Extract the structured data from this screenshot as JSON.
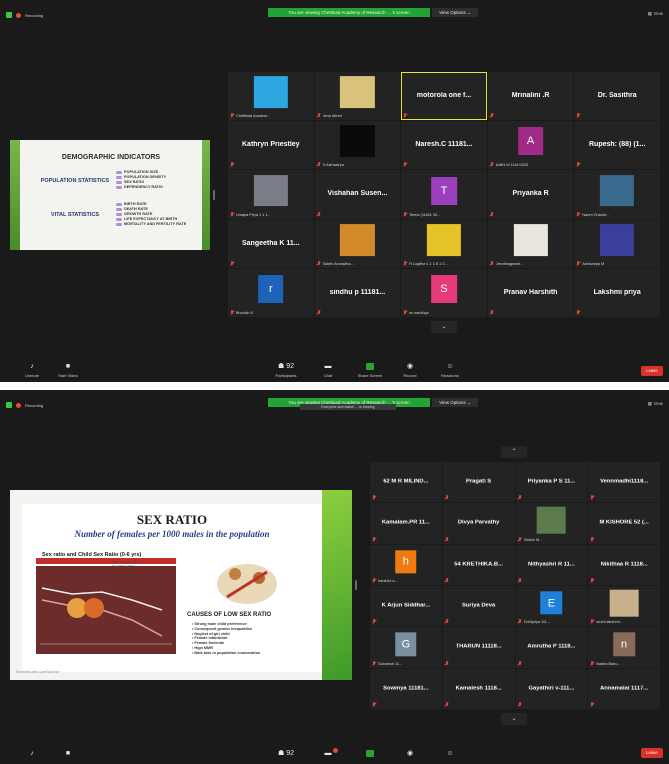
{
  "shots": [
    {
      "recording": "Recording",
      "banner": "You are viewing Chettinad Academy of Research ... 's screen",
      "view_options": "View Options ⌄",
      "view": "View",
      "slide": {
        "title": "DEMOGRAPHIC INDICATORS",
        "population_heading": "POPULATION STATISTICS",
        "population_items": [
          "POPULATION SIZE",
          "POPULATION DENSITY",
          "SEX RATIO",
          "DEPENDENCY RATIO"
        ],
        "vital_heading": "VITAL STATISTICS",
        "vital_items": [
          "BIRTH RATE",
          "DEATH RATE",
          "GROWTH RATE",
          "LIFE EXPECTANCY AT BIRTH",
          "MORTALITY AND FERTILITY RATE"
        ]
      },
      "tiles": [
        {
          "type": "image",
          "color": "#2ea6e0",
          "label": "Chettinad Academ..."
        },
        {
          "type": "image",
          "color": "#d9c27a",
          "label": "Jerry Alfred"
        },
        {
          "type": "name",
          "name": "motorola one f...",
          "active": true
        },
        {
          "type": "name",
          "name": "Mrinalini .R"
        },
        {
          "type": "name",
          "name": "Dr. Sasithra"
        },
        {
          "type": "name",
          "name": "Kathryn Priestley"
        },
        {
          "type": "image",
          "color": "#0a0a0a",
          "label": "D Aishwarya"
        },
        {
          "type": "name",
          "name": "Naresh.C 11181..."
        },
        {
          "type": "letter",
          "letter": "A",
          "color": "#a02a86",
          "label": "Adithi M 1118 0003"
        },
        {
          "type": "name",
          "name": "Rupesh: (88) (1..."
        },
        {
          "type": "image",
          "color": "#7a7d88",
          "label": "Umapa Priya 1 1 1..."
        },
        {
          "type": "name",
          "name": "Vishahan Susen..."
        },
        {
          "type": "letter",
          "letter": "T",
          "color": "#9b3fbf",
          "label": "Teena (11811 00..."
        },
        {
          "type": "name",
          "name": "Priyanka R"
        },
        {
          "type": "image",
          "color": "#3a6b8f",
          "label": "Naren Chandr..."
        },
        {
          "type": "name",
          "name": "Sangeetha K 11..."
        },
        {
          "type": "image",
          "color": "#d38a2b",
          "label": "Sakthi Anuradha..."
        },
        {
          "type": "image",
          "color": "#e7c32a",
          "label": "R Logitha 1 1 1 8 1 0..."
        },
        {
          "type": "image",
          "color": "#e9e6df",
          "label": "Jeevithagnesh..."
        },
        {
          "type": "image",
          "color": "#3b3f9b",
          "label": "Aishwarya M"
        },
        {
          "type": "letter",
          "letter": "r",
          "color": "#1e63b8",
          "label": "Bhuvish.K"
        },
        {
          "type": "name",
          "name": "sindhu p 11181..."
        },
        {
          "type": "letter",
          "letter": "S",
          "color": "#e53b7a",
          "label": "sri sandhya"
        },
        {
          "type": "name",
          "name": "Pranav Harshith"
        },
        {
          "type": "name",
          "name": "Lakshmi priya"
        }
      ],
      "toolbar": [
        {
          "icon": "microphone-icon",
          "label": "Unmute",
          "glyph": "♪"
        },
        {
          "icon": "video-icon",
          "label": "Start Video",
          "glyph": "■"
        },
        {
          "icon": "participants-icon",
          "label": "Participants",
          "glyph": "☗ 92"
        },
        {
          "icon": "chat-icon",
          "label": "Chat",
          "glyph": "▬"
        },
        {
          "icon": "share-screen-icon",
          "label": "Share Screen",
          "glyph": ""
        },
        {
          "icon": "record-icon",
          "label": "Record",
          "glyph": "◉"
        },
        {
          "icon": "reactions-icon",
          "label": "Reactions",
          "glyph": "☺"
        }
      ],
      "leave": "Leave"
    },
    {
      "recording": "Recording",
      "banner": "You are viewing Chettinad Academy of Research ... 's screen",
      "banner_sub": "Everyone and Isabel ... is viewing",
      "view_options": "View Options ⌄",
      "view": "View",
      "slide": {
        "title": "SEX RATIO",
        "subtitle": "Number of females per 1000 males in the population",
        "chart_title": "Sex ratio and Child Sex Ratio (0-6 yrs)",
        "legend": [
          "Child Sex Ratio (0-6)",
          "Overall Sex Ratio"
        ],
        "causes_title": "CAUSES OF LOW SEX RATIO",
        "causes": [
          "Strong male child preference",
          "Consequent gender inequalities",
          "Neglect of girl child",
          "Female infanticide",
          "Female foeticide",
          "High MMR",
          "Male bias in population enumeration"
        ],
        "footer": "Scanned with CamScanner"
      },
      "tiles": [
        {
          "type": "name",
          "name": "62 M R MILIND..."
        },
        {
          "type": "name",
          "name": "Pragati S"
        },
        {
          "type": "name",
          "name": "Priyanka P S 11..."
        },
        {
          "type": "name",
          "name": "Vennmadhi1118..."
        },
        {
          "type": "name",
          "name": "Kamalam.PR 11..."
        },
        {
          "type": "name",
          "name": "Divya Parvathy"
        },
        {
          "type": "image",
          "color": "#5d7a4a",
          "label": "Shalini M..."
        },
        {
          "type": "name",
          "name": "M KISHORE 52 (..."
        },
        {
          "type": "letter",
          "letter": "h",
          "color": "#f07a12",
          "label": "harshini a..."
        },
        {
          "type": "name",
          "name": "54 KRETHIKA.B..."
        },
        {
          "type": "name",
          "name": "Nithyashri R 11..."
        },
        {
          "type": "name",
          "name": "Nikithaa R 1118..."
        },
        {
          "type": "name",
          "name": "K Arjun Siddhar..."
        },
        {
          "type": "name",
          "name": "Suriya Deva"
        },
        {
          "type": "letter",
          "letter": "E",
          "color": "#1f80d8",
          "label": "Ezhilpriya 111..."
        },
        {
          "type": "image",
          "color": "#c8b08a",
          "label": "sruthi lakshmi..."
        },
        {
          "type": "letter",
          "letter": "G",
          "color": "#7a8fa0",
          "label": "Gokulesh 11..."
        },
        {
          "type": "name",
          "name": "THARUN 11118..."
        },
        {
          "type": "name",
          "name": "Amrutha P 1118..."
        },
        {
          "type": "letter",
          "letter": "n",
          "color": "#8a6a5a",
          "label": "Nadira Banu..."
        },
        {
          "type": "name",
          "name": "Sowmya 11181..."
        },
        {
          "type": "name",
          "name": "Kamalesh 1118..."
        },
        {
          "type": "name",
          "name": "Gayathiri v-111..."
        },
        {
          "type": "name",
          "name": "Annamalai 1117..."
        }
      ],
      "toolbar": [
        {
          "icon": "microphone-icon",
          "label": "",
          "glyph": "♪"
        },
        {
          "icon": "video-icon",
          "label": "",
          "glyph": "■"
        },
        {
          "icon": "participants-icon",
          "label": "",
          "glyph": "☗ 92"
        },
        {
          "icon": "chat-icon",
          "label": "",
          "glyph": "▬"
        },
        {
          "icon": "share-screen-icon",
          "label": "",
          "glyph": ""
        },
        {
          "icon": "record-icon",
          "label": "",
          "glyph": "◉"
        },
        {
          "icon": "reactions-icon",
          "label": "",
          "glyph": "☺"
        }
      ],
      "leave": "Leave"
    }
  ]
}
